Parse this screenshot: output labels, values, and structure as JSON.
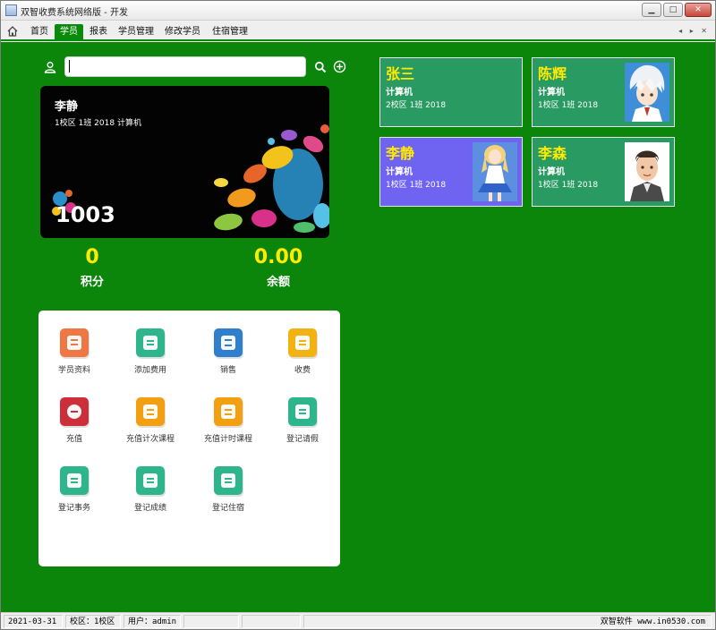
{
  "window": {
    "title": "双智收费系统网络版 - 开发"
  },
  "tabs": [
    {
      "label": "首页",
      "active": false
    },
    {
      "label": "学员",
      "active": true
    },
    {
      "label": "报表",
      "active": false
    },
    {
      "label": "学员管理",
      "active": false
    },
    {
      "label": "修改学员",
      "active": false
    },
    {
      "label": "住宿管理",
      "active": false
    }
  ],
  "search": {
    "value": "",
    "placeholder": ""
  },
  "student_card": {
    "name": "李静",
    "info": "1校区 1班 2018 计算机",
    "number": "1003"
  },
  "stats": {
    "points_value": "0",
    "points_label": "积分",
    "balance_value": "0.00",
    "balance_label": "余额"
  },
  "functions": [
    {
      "label": "学员资料",
      "icon": "profile-icon",
      "color": "#ef7744"
    },
    {
      "label": "添加费用",
      "icon": "add-fee-icon",
      "color": "#2fb58b"
    },
    {
      "label": "销售",
      "icon": "sales-icon",
      "color": "#2f7fcd"
    },
    {
      "label": "收费",
      "icon": "charge-icon",
      "color": "#f2b312"
    },
    {
      "label": "充值",
      "icon": "recharge-icon",
      "color": "#cc2f3a"
    },
    {
      "label": "充值计次课程",
      "icon": "count-course-icon",
      "color": "#f2a012"
    },
    {
      "label": "充值计时课程",
      "icon": "time-course-icon",
      "color": "#f2a012"
    },
    {
      "label": "登记请假",
      "icon": "leave-icon",
      "color": "#2fb58b"
    },
    {
      "label": "登记事务",
      "icon": "affair-icon",
      "color": "#2fb58b"
    },
    {
      "label": "登记成绩",
      "icon": "score-icon",
      "color": "#2fb58b"
    },
    {
      "label": "登记住宿",
      "icon": "dorm-icon",
      "color": "#2fb58b"
    }
  ],
  "students": [
    {
      "name": "张三",
      "major": "计算机",
      "info": "2校区 1班 2018",
      "selected": false,
      "avatar": "none"
    },
    {
      "name": "陈辉",
      "major": "计算机",
      "info": "1校区 1班 2018",
      "selected": false,
      "avatar": "silver-hair-anime-avatar"
    },
    {
      "name": "李静",
      "major": "计算机",
      "info": "1校区 1班 2018",
      "selected": true,
      "avatar": "blue-dress-anime-avatar"
    },
    {
      "name": "李森",
      "major": "计算机",
      "info": "1校区 1班 2018",
      "selected": false,
      "avatar": "cartoon-man-avatar"
    }
  ],
  "status": {
    "date": "2021-03-31",
    "campus": "校区：1校区",
    "user": "用户：admin",
    "vendor": "双智软件 www.in0530.com"
  },
  "colors": {
    "background": "#0b860b",
    "tile": "#2a9a63",
    "tile_selected": "#6f63f2",
    "highlight_text": "#ffea00"
  }
}
